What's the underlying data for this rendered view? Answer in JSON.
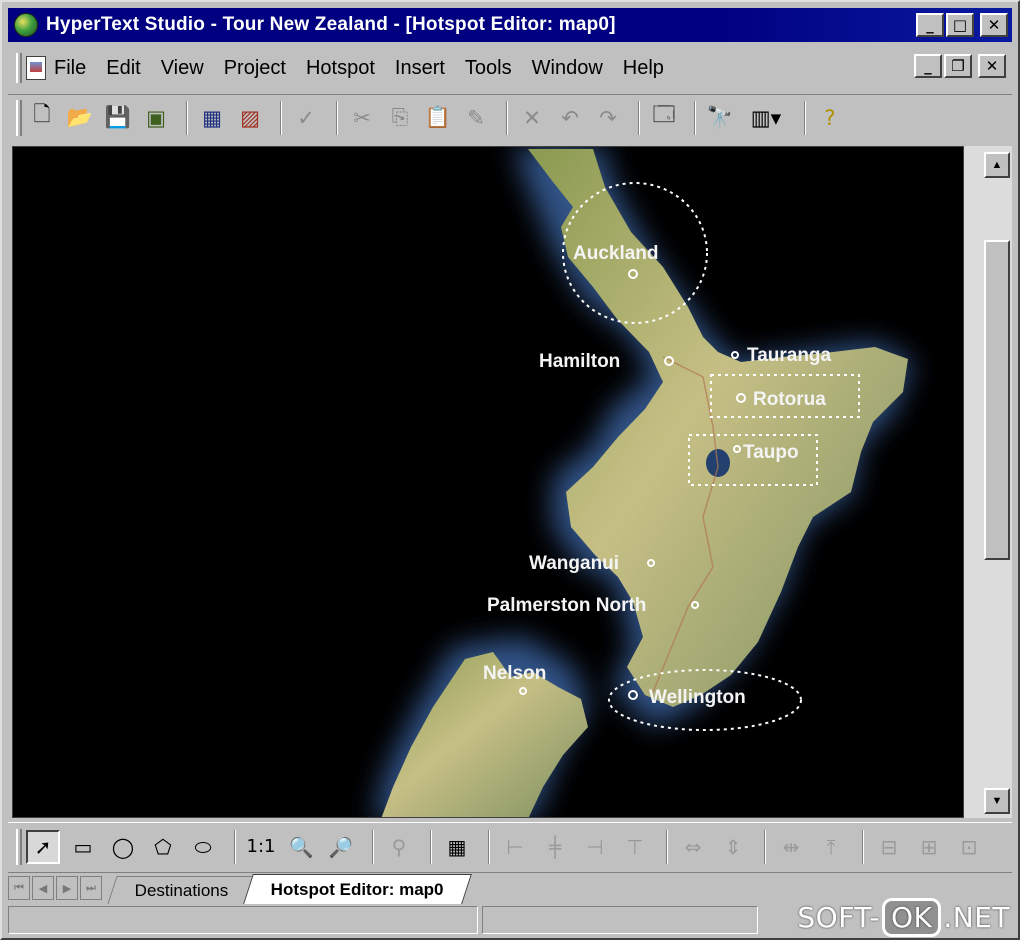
{
  "window": {
    "title": "HyperText Studio - Tour New Zealand - [Hotspot Editor: map0]",
    "controls": {
      "minimize": "_",
      "maximize": "□",
      "close": "✕"
    }
  },
  "menu": {
    "items": [
      "File",
      "Edit",
      "View",
      "Project",
      "Hotspot",
      "Insert",
      "Tools",
      "Window",
      "Help"
    ],
    "mdi_controls": {
      "minimize": "_",
      "restore": "❐",
      "close": "✕"
    }
  },
  "toolbar": {
    "icons": [
      "new-document-icon",
      "open-folder-icon",
      "save-icon",
      "save-all-icon",
      "preview-icon",
      "image-icon",
      "spell-check-icon",
      "cut-icon",
      "copy-icon",
      "paste-icon",
      "format-painter-icon",
      "delete-icon",
      "undo-icon",
      "redo-icon",
      "properties-icon",
      "find-icon",
      "view-dropdown-icon",
      "help-icon"
    ]
  },
  "map": {
    "cities": [
      {
        "name": "Auckland"
      },
      {
        "name": "Hamilton"
      },
      {
        "name": "Tauranga"
      },
      {
        "name": "Rotorua"
      },
      {
        "name": "Taupo"
      },
      {
        "name": "Wanganui"
      },
      {
        "name": "Palmerston North"
      },
      {
        "name": "Nelson"
      },
      {
        "name": "Wellington"
      }
    ],
    "colors": {
      "sea": "#000000",
      "land": "#b8b878",
      "coast_glow": "#3a5a90",
      "hotspot_outline": "#ffffff"
    }
  },
  "drawing_toolbar": {
    "zoom_label": "1:1",
    "icons": [
      "select-arrow-icon",
      "rectangle-tool-icon",
      "ellipse-tool-icon",
      "polygon-tool-icon",
      "freeform-tool-icon",
      "zoom-in-icon",
      "zoom-out-icon",
      "hotspot-test-icon",
      "grid-icon",
      "align-left-icon",
      "align-center-icon",
      "align-right-icon",
      "align-top-icon",
      "same-width-icon",
      "same-height-icon",
      "space-horizontal-icon",
      "space-vertical-icon",
      "bring-front-icon",
      "send-back-icon",
      "center-icon"
    ]
  },
  "tabs": [
    {
      "label": "Destinations",
      "active": false
    },
    {
      "label": "Hotspot Editor: map0",
      "active": true
    }
  ],
  "watermark": {
    "left": "SOFT-",
    "box": "OK",
    "right": ".NET"
  }
}
